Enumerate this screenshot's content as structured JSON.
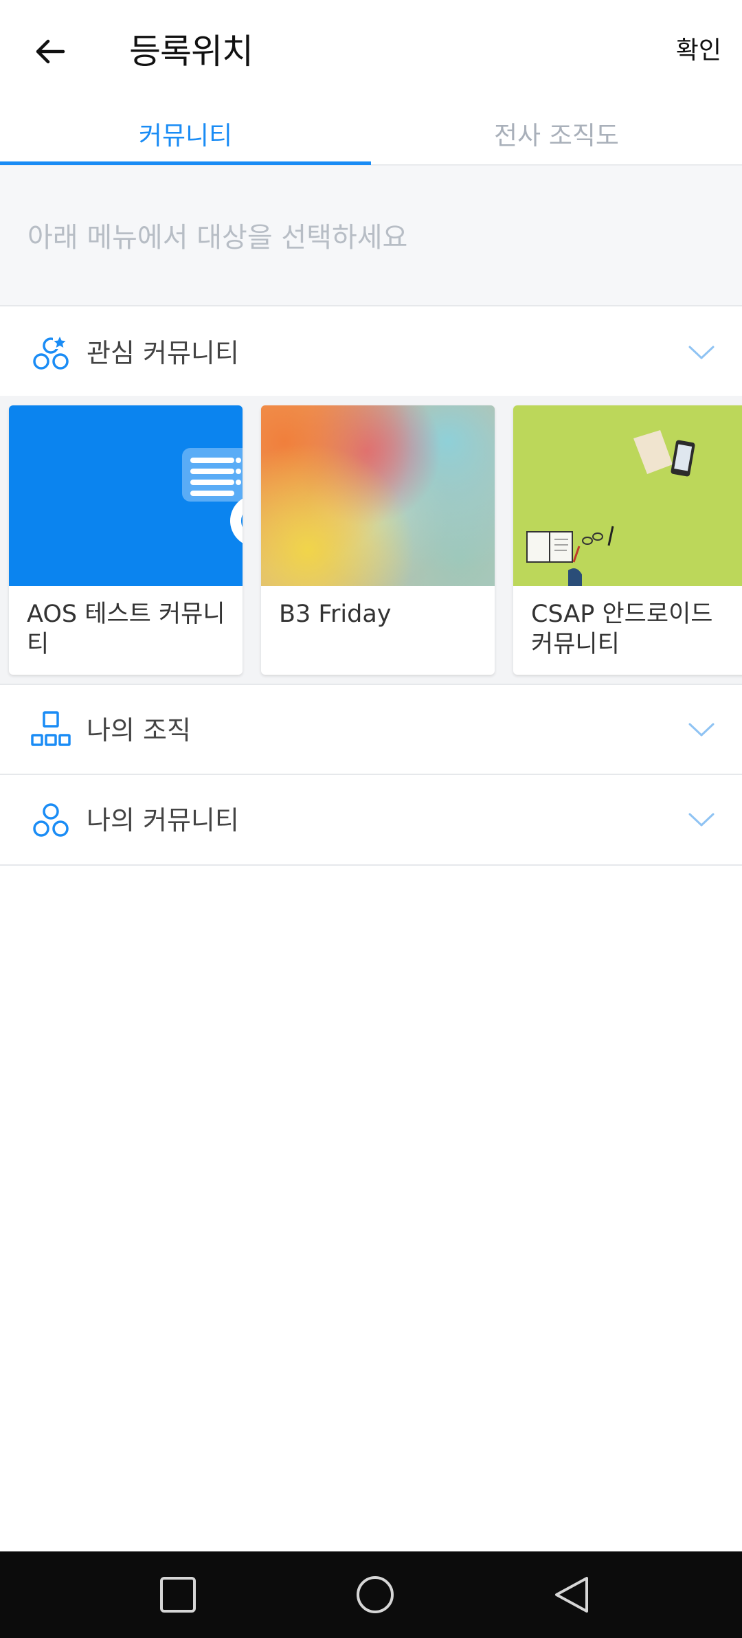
{
  "header": {
    "title": "등록위치",
    "confirm_label": "확인",
    "back_icon": "arrow-left-icon"
  },
  "tabs": [
    {
      "label": "커뮤니티",
      "active": true
    },
    {
      "label": "전사 조직도",
      "active": false
    }
  ],
  "hint": {
    "text": "아래 메뉴에서 대상을 선택하세요"
  },
  "sections": {
    "interest": {
      "label": "관심 커뮤니티",
      "icon": "favorite-community-icon"
    },
    "org": {
      "label": "나의 조직",
      "icon": "organization-icon"
    },
    "mine": {
      "label": "나의 커뮤니티",
      "icon": "community-icon"
    }
  },
  "cards": [
    {
      "name": "AOS 테스트 커뮤니티"
    },
    {
      "name": "B3 Friday"
    },
    {
      "name": "CSAP 안드로이드 커뮤니티"
    }
  ],
  "colors": {
    "accent": "#1a8cf5",
    "inactive_tab": "#a9b0ba",
    "hint_text": "#b7bdc5"
  },
  "navbar": {
    "recent_icon": "square-icon",
    "home_icon": "circle-icon",
    "back_icon": "triangle-back-icon"
  }
}
